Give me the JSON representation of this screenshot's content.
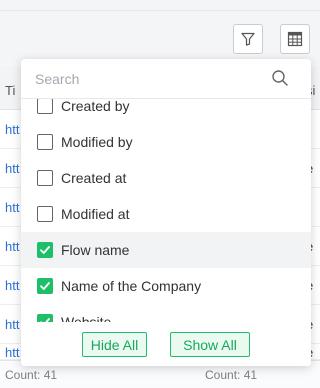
{
  "toolbar": {
    "filter_icon": "filter-icon",
    "columns_icon": "column-grid-icon"
  },
  "grid": {
    "header_col1": "Ti",
    "header_col2": "si",
    "rows": [
      {
        "link": "htt",
        "cell2": ""
      },
      {
        "link": "htt",
        "cell2": "e"
      },
      {
        "link": "htt",
        "cell2": "i"
      },
      {
        "link": "htt",
        "cell2": "e"
      },
      {
        "link": "htt",
        "cell2": "e"
      },
      {
        "link": "htt",
        "cell2": "e"
      },
      {
        "link": "htt",
        "cell2": "e"
      }
    ],
    "footer_left": "Count: 41",
    "footer_right": "Count: 41"
  },
  "column_picker": {
    "search_placeholder": "Search",
    "items": [
      {
        "label": "Created by",
        "checked": false
      },
      {
        "label": "Modified by",
        "checked": false
      },
      {
        "label": "Created at",
        "checked": false
      },
      {
        "label": "Modified at",
        "checked": false
      },
      {
        "label": "Flow name",
        "checked": true
      },
      {
        "label": "Name of the Company",
        "checked": true
      },
      {
        "label": "Website",
        "checked": true
      }
    ],
    "hide_all_label": "Hide All",
    "show_all_label": "Show All"
  },
  "colors": {
    "accent": "#1fbf6a",
    "link": "#2a6fd6"
  }
}
